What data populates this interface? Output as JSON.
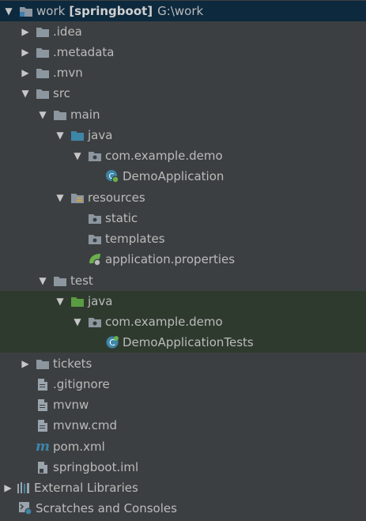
{
  "tree": {
    "root": {
      "name": "work",
      "module": "[springboot]",
      "path": "G:\\work",
      "icon": "module-folder-icon"
    },
    "items": [
      {
        "label": ".idea",
        "icon": "folder-icon"
      },
      {
        "label": ".metadata",
        "icon": "folder-icon"
      },
      {
        "label": ".mvn",
        "icon": "folder-icon"
      },
      {
        "label": "src",
        "icon": "folder-icon"
      },
      {
        "label": "main",
        "icon": "folder-icon"
      },
      {
        "label": "java",
        "icon": "source-root-icon"
      },
      {
        "label": "com.example.demo",
        "icon": "package-icon"
      },
      {
        "label": "DemoApplication",
        "icon": "spring-boot-class-icon"
      },
      {
        "label": "resources",
        "icon": "resources-root-icon"
      },
      {
        "label": "static",
        "icon": "package-icon"
      },
      {
        "label": "templates",
        "icon": "package-icon"
      },
      {
        "label": "application.properties",
        "icon": "spring-properties-icon"
      },
      {
        "label": "test",
        "icon": "folder-icon"
      },
      {
        "label": "java",
        "icon": "test-root-icon"
      },
      {
        "label": "com.example.demo",
        "icon": "package-icon"
      },
      {
        "label": "DemoApplicationTests",
        "icon": "class-icon"
      },
      {
        "label": "tickets",
        "icon": "folder-icon"
      },
      {
        "label": ".gitignore",
        "icon": "file-icon"
      },
      {
        "label": "mvnw",
        "icon": "file-icon"
      },
      {
        "label": "mvnw.cmd",
        "icon": "file-icon"
      },
      {
        "label": "pom.xml",
        "icon": "maven-icon"
      },
      {
        "label": "springboot.iml",
        "icon": "iml-file-icon"
      },
      {
        "label": "External Libraries",
        "icon": "libraries-icon"
      },
      {
        "label": "Scratches and Consoles",
        "icon": "scratches-icon"
      }
    ]
  },
  "colors": {
    "background": "#3c3f41",
    "selection": "#0d293e",
    "test_highlight": "#2f3a2f",
    "folder": "#8c969f",
    "source_root": "#3d86a8",
    "test_root": "#5a9c41",
    "spring_green": "#6ab04c"
  }
}
